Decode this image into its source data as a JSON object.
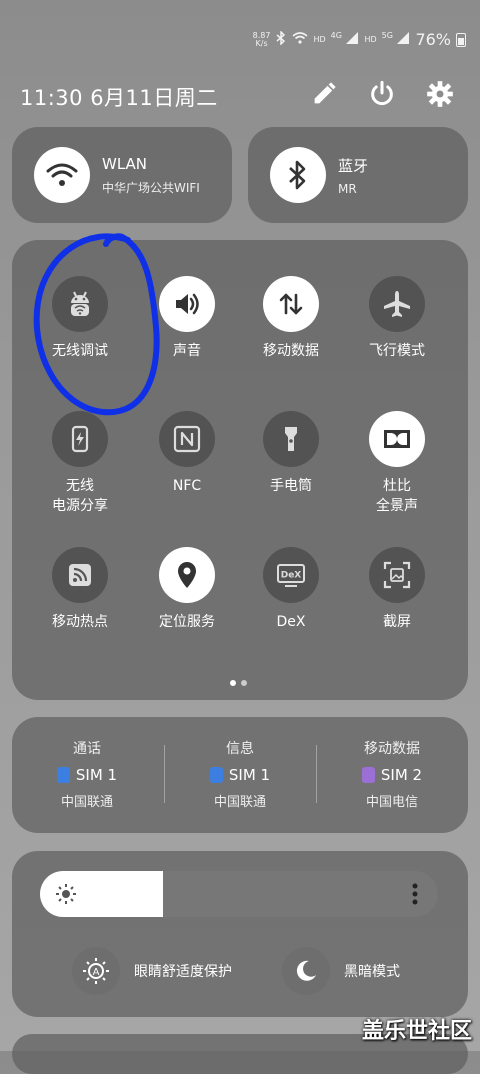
{
  "status_bar": {
    "net_speed_value": "8.87",
    "net_speed_unit": "K/s",
    "battery": "76%",
    "hd1": "HD",
    "sig1": "4G",
    "hd2": "HD",
    "sig2": "5G"
  },
  "header": {
    "datetime": "11:30  6月11日周二"
  },
  "connections": {
    "wlan": {
      "title": "WLAN",
      "subtitle": "中华广场公共WIFI"
    },
    "bluetooth": {
      "title": "蓝牙",
      "subtitle": "MR"
    }
  },
  "tiles": [
    {
      "label": "无线调试",
      "icon": "android-debug-icon",
      "state": "off"
    },
    {
      "label": "声音",
      "icon": "volume-icon",
      "state": "on"
    },
    {
      "label": "移动数据",
      "icon": "data-transfer-icon",
      "state": "on"
    },
    {
      "label": "飞行模式",
      "icon": "airplane-icon",
      "state": "off"
    },
    {
      "label": "无线\n电源分享",
      "icon": "power-share-icon",
      "state": "off"
    },
    {
      "label": "NFC",
      "icon": "nfc-icon",
      "state": "off"
    },
    {
      "label": "手电筒",
      "icon": "flashlight-icon",
      "state": "off"
    },
    {
      "label": "杜比\n全景声",
      "icon": "dolby-icon",
      "state": "on"
    },
    {
      "label": "移动热点",
      "icon": "hotspot-icon",
      "state": "off"
    },
    {
      "label": "定位服务",
      "icon": "location-icon",
      "state": "on"
    },
    {
      "label": "DeX",
      "icon": "dex-icon",
      "state": "off"
    },
    {
      "label": "截屏",
      "icon": "screenshot-icon",
      "state": "off"
    }
  ],
  "sim_panel": [
    {
      "heading": "通话",
      "sim": "SIM 1",
      "carrier": "中国联通",
      "color": "#3d7fe0"
    },
    {
      "heading": "信息",
      "sim": "SIM 1",
      "carrier": "中国联通",
      "color": "#3d7fe0"
    },
    {
      "heading": "移动数据",
      "sim": "SIM 2",
      "carrier": "中国电信",
      "color": "#9b6fd6"
    }
  ],
  "brightness": {
    "level": 0.31
  },
  "modes": {
    "eye_comfort": "眼睛舒适度保护",
    "dark_mode": "黑暗模式"
  },
  "page_dots": {
    "count": 2,
    "active": 0
  },
  "watermark": "盖乐世社区",
  "colors": {
    "annotation": "#1030e8"
  }
}
